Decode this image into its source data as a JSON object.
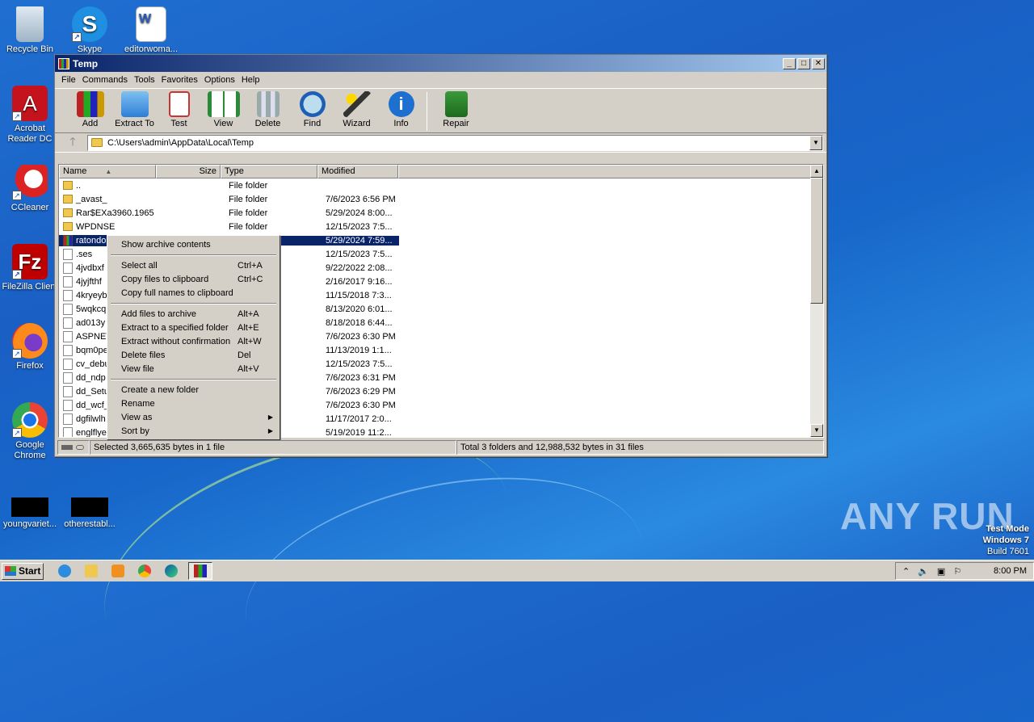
{
  "desktop": {
    "icons": [
      {
        "label": "Recycle Bin"
      },
      {
        "label": "Skype"
      },
      {
        "label": "editorwoma..."
      },
      {
        "label": "Acrobat Reader DC"
      },
      {
        "label": "CCleaner"
      },
      {
        "label": "FileZilla Client"
      },
      {
        "label": "Firefox"
      },
      {
        "label": "Google Chrome"
      },
      {
        "label": "youngvariet..."
      },
      {
        "label": "otherestabl..."
      }
    ],
    "watermark": "ANY RUN",
    "testmode": {
      "line1": "Test Mode",
      "line2": "Windows 7",
      "line3": "Build 7601"
    }
  },
  "window": {
    "title": "Temp",
    "menu": [
      "File",
      "Commands",
      "Tools",
      "Favorites",
      "Options",
      "Help"
    ],
    "toolbar": [
      "Add",
      "Extract To",
      "Test",
      "View",
      "Delete",
      "Find",
      "Wizard",
      "Info",
      "Repair"
    ],
    "address": "C:\\Users\\admin\\AppData\\Local\\Temp",
    "columns": {
      "name": "Name",
      "size": "Size",
      "type": "Type",
      "modified": "Modified"
    },
    "rows": [
      {
        "name": "..",
        "size": "",
        "type": "File folder",
        "modified": "",
        "icon": "folder"
      },
      {
        "name": "_avast_",
        "size": "",
        "type": "File folder",
        "modified": "7/6/2023 6:56 PM",
        "icon": "folder"
      },
      {
        "name": "Rar$EXa3960.1965",
        "size": "",
        "type": "File folder",
        "modified": "5/29/2024 8:00...",
        "icon": "folder"
      },
      {
        "name": "WPDNSE",
        "size": "",
        "type": "File folder",
        "modified": "12/15/2023 7:5...",
        "icon": "folder"
      },
      {
        "name": "ratondo",
        "size": "",
        "type": "e",
        "modified": "5/29/2024 7:59...",
        "icon": "rar"
      },
      {
        "name": ".ses",
        "size": "",
        "type": "",
        "modified": "12/15/2023 7:5...",
        "icon": "file"
      },
      {
        "name": "4jvdbxf",
        "size": "",
        "type": "",
        "modified": "9/22/2022 2:08...",
        "icon": "file"
      },
      {
        "name": "4jyjfthf",
        "size": "",
        "type": "",
        "modified": "2/16/2017 9:16...",
        "icon": "file"
      },
      {
        "name": "4kryeyb",
        "size": "",
        "type": "",
        "modified": "11/15/2018 7:3...",
        "icon": "file"
      },
      {
        "name": "5wqkcq",
        "size": "",
        "type": "",
        "modified": "8/13/2020 6:01...",
        "icon": "file"
      },
      {
        "name": "ad013y",
        "size": "",
        "type": "",
        "modified": "8/18/2018 6:44...",
        "icon": "file"
      },
      {
        "name": "ASPNET",
        "size": "",
        "type": "",
        "modified": "7/6/2023 6:30 PM",
        "icon": "file"
      },
      {
        "name": "bqm0pe",
        "size": "",
        "type": "",
        "modified": "11/13/2019 1:1...",
        "icon": "file"
      },
      {
        "name": "cv_debu",
        "size": "",
        "type": "",
        "modified": "12/15/2023 7:5...",
        "icon": "file"
      },
      {
        "name": "dd_ndp",
        "size": "",
        "type": "",
        "modified": "7/6/2023 6:31 PM",
        "icon": "file"
      },
      {
        "name": "dd_Setu",
        "size": "",
        "type": "",
        "modified": "7/6/2023 6:29 PM",
        "icon": "file"
      },
      {
        "name": "dd_wcf_",
        "size": "",
        "type": "",
        "modified": "7/6/2023 6:30 PM",
        "icon": "file"
      },
      {
        "name": "dgfilwlh",
        "size": "",
        "type": "",
        "modified": "11/17/2017 2:0...",
        "icon": "file"
      },
      {
        "name": "englflye",
        "size": "",
        "type": "",
        "modified": "5/19/2019 11:2...",
        "icon": "file"
      }
    ],
    "status_left": "Selected 3,665,635 bytes in 1 file",
    "status_right": "Total 3 folders and 12,988,532 bytes in 31 files"
  },
  "context_menu": {
    "groups": [
      [
        {
          "label": "Show archive contents",
          "shortcut": ""
        }
      ],
      [
        {
          "label": "Select all",
          "shortcut": "Ctrl+A"
        },
        {
          "label": "Copy files to clipboard",
          "shortcut": "Ctrl+C"
        },
        {
          "label": "Copy full names to clipboard",
          "shortcut": ""
        }
      ],
      [
        {
          "label": "Add files to archive",
          "shortcut": "Alt+A"
        },
        {
          "label": "Extract to a specified folder",
          "shortcut": "Alt+E"
        },
        {
          "label": "Extract without confirmation",
          "shortcut": "Alt+W"
        },
        {
          "label": "Delete files",
          "shortcut": "Del"
        },
        {
          "label": "View file",
          "shortcut": "Alt+V"
        }
      ],
      [
        {
          "label": "Create a new folder",
          "shortcut": ""
        },
        {
          "label": "Rename",
          "shortcut": ""
        },
        {
          "label": "View as",
          "shortcut": "",
          "submenu": true
        },
        {
          "label": "Sort by",
          "shortcut": "",
          "submenu": true
        }
      ]
    ]
  },
  "taskbar": {
    "start": "Start",
    "clock": "8:00 PM"
  }
}
